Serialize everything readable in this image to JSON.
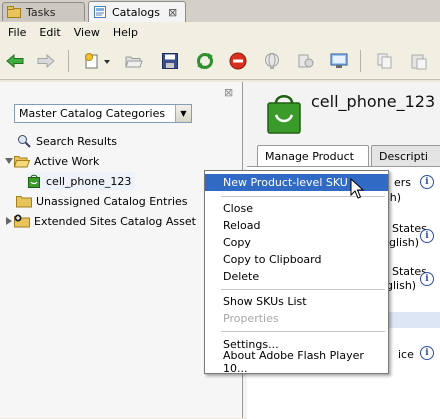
{
  "tabs": [
    {
      "label": "Tasks",
      "icon": "tasks-folder-icon"
    },
    {
      "label": "Catalogs",
      "icon": "catalogs-icon",
      "close": "⊠"
    }
  ],
  "menubar": [
    "File",
    "Edit",
    "View",
    "Help"
  ],
  "toolbar_icons": [
    "back-arrow-icon",
    "forward-arrow-icon",
    "new-item-icon",
    "open-folder-icon",
    "save-icon",
    "refresh-icon",
    "stop-icon",
    "globe-icon",
    "link-icon",
    "preview-icon",
    "copy-icon",
    "paste-icon"
  ],
  "left": {
    "close": "⊠",
    "dropdown_value": "Master Catalog Categories",
    "tree": [
      {
        "label": "Search Results",
        "icon": "search-icon"
      },
      {
        "label": "Active Work",
        "icon": "folder-open-icon"
      },
      {
        "label": "cell_phone_123",
        "icon": "product-bag-icon"
      },
      {
        "label": "Unassigned Catalog Entries",
        "icon": "folder-icon"
      },
      {
        "label": "Extended Sites Catalog Asset",
        "icon": "store-folder-icon"
      }
    ]
  },
  "right": {
    "title": "cell_phone_123",
    "tabs": [
      "Manage Product",
      "Descripti"
    ],
    "fragments": [
      "ers",
      "sh)",
      "States",
      "nglish)",
      "States",
      "glish)",
      "ice"
    ]
  },
  "context_menu": {
    "items": [
      {
        "label": "New Product-level SKU",
        "state": "highlighted"
      },
      {
        "label": "Close"
      },
      {
        "label": "Reload"
      },
      {
        "label": "Copy"
      },
      {
        "label": "Copy to Clipboard"
      },
      {
        "label": "Delete"
      },
      {
        "label": "Show SKUs List"
      },
      {
        "label": "Properties",
        "state": "disabled"
      },
      {
        "label": "Settings..."
      },
      {
        "label": "About Adobe Flash Player 10..."
      }
    ]
  },
  "colors": {
    "highlight": "#316ac5",
    "bag_green": "#3a9a2a",
    "stop_red": "#d83020",
    "refresh_green": "#2f8f2f"
  }
}
